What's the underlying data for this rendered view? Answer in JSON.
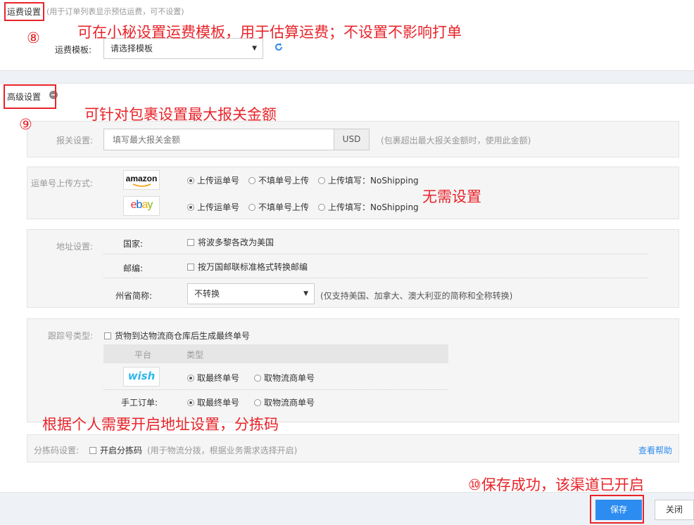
{
  "freight": {
    "section_title": "运费设置",
    "section_hint": "(用于订单列表显示预估运费，可不设置)",
    "template_label": "运费模板:",
    "template_value": "请选择模板"
  },
  "advanced": {
    "section_title": "高级设置"
  },
  "customs": {
    "label": "报关设置:",
    "placeholder": "填写最大报关金额",
    "currency": "USD",
    "hint": "(包裹超出最大报关金额时，使用此金额)"
  },
  "tracking_upload": {
    "label": "运单号上传方式:",
    "platforms": [
      {
        "logo_text": "amazon",
        "options": [
          "上传运单号",
          "不填单号上传",
          "上传填写：NoShipping"
        ],
        "selected": 0
      },
      {
        "logo_text": "ebay",
        "options": [
          "上传运单号",
          "不填单号上传",
          "上传填写：NoShipping"
        ],
        "selected": 0
      }
    ]
  },
  "address": {
    "label": "地址设置:",
    "country_label": "国家:",
    "country_option": "将波多黎各改为美国",
    "zip_label": "邮编:",
    "zip_option": "按万国邮联标准格式转换邮编",
    "state_label": "州省简称:",
    "state_value": "不转换",
    "state_hint": "(仅支持美国、加拿大、澳大利亚的简称和全称转换)"
  },
  "tracking_type": {
    "label": "跟踪号类型:",
    "checkbox_label": "货物到达物流商仓库后生成最终单号",
    "col_platform": "平台",
    "col_type": "类型",
    "rows": [
      {
        "platform": "wish",
        "options": [
          "取最终单号",
          "取物流商单号"
        ],
        "selected": 0
      },
      {
        "platform": "手工订单:",
        "options": [
          "取最终单号",
          "取物流商单号"
        ],
        "selected": 0
      }
    ]
  },
  "sorting": {
    "label": "分拣码设置:",
    "checkbox_label": "开启分拣码",
    "hint": "(用于物流分拨，根据业务需求选择开启)",
    "help_link": "查看帮助"
  },
  "footer": {
    "save_label": "保存",
    "close_label": "关闭"
  },
  "annotations": {
    "a8_num": "⑧",
    "a8_text": "可在小秘设置运费模板，用于估算运费；不设置不影响打单",
    "a9_num": "⑨",
    "a9_text": "可针对包裹设置最大报关金额",
    "no_setting": "无需设置",
    "personal": "根据个人需要开启地址设置，分拣码",
    "a10": "⑩保存成功，该渠道已开启"
  },
  "colors": {
    "annotation_red": "#e8242a",
    "primary_blue": "#2d8cf0",
    "panel_gray": "#f5f5f5",
    "amazon_orange": "#ff9900",
    "ebay_red": "#e53238",
    "ebay_blue": "#0064d2",
    "ebay_yellow": "#f5af02",
    "ebay_green": "#86b817",
    "wish_blue": "#2fb7ec"
  }
}
